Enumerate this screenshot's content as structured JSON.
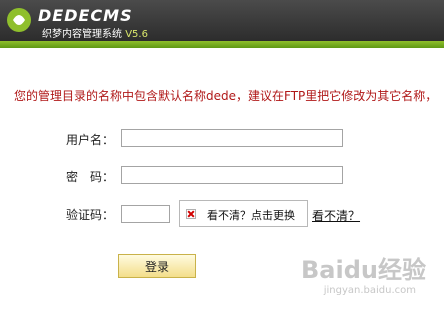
{
  "header": {
    "brand": "DEDECMS",
    "subtitle": "织梦内容管理系统",
    "version": "V5.6"
  },
  "notice": "您的管理目录的名称中包含默认名称dede，建议在FTP里把它修改为其它名称，",
  "form": {
    "username_label": "用户名：",
    "username_value": "",
    "password_label": "密　码：",
    "password_value": "",
    "captcha_label": "验证码：",
    "captcha_value": "",
    "captcha_image_alt": "看不清？点击更换",
    "captcha_refresh_link": "看不清？",
    "login_button": "登录"
  },
  "watermark": {
    "text": "Baidu经验",
    "subtext": "jingyan.baidu.com"
  },
  "colors": {
    "header_dark": "#2a2a2a",
    "header_green": "#5f9914",
    "notice_red": "#b01818",
    "button_fill": "#f3de8a"
  }
}
